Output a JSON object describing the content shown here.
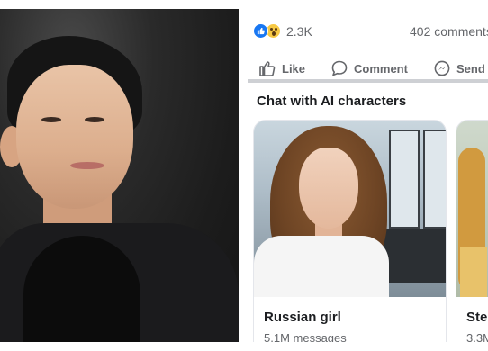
{
  "post": {
    "reaction_icons": [
      "like-icon",
      "wow-icon"
    ],
    "reaction_count": "2.3K",
    "comments_count": "402 comments"
  },
  "actions": {
    "like_label": "Like",
    "comment_label": "Comment",
    "send_label": "Send"
  },
  "section": {
    "title": "Chat with AI characters"
  },
  "characters": [
    {
      "name": "Russian girl",
      "messages": "5.1M messages"
    },
    {
      "name": "Ste",
      "messages": "3.3M"
    }
  ],
  "colors": {
    "accent": "#1877f2",
    "text_primary": "#1c1e21",
    "text_secondary": "#65676b"
  }
}
